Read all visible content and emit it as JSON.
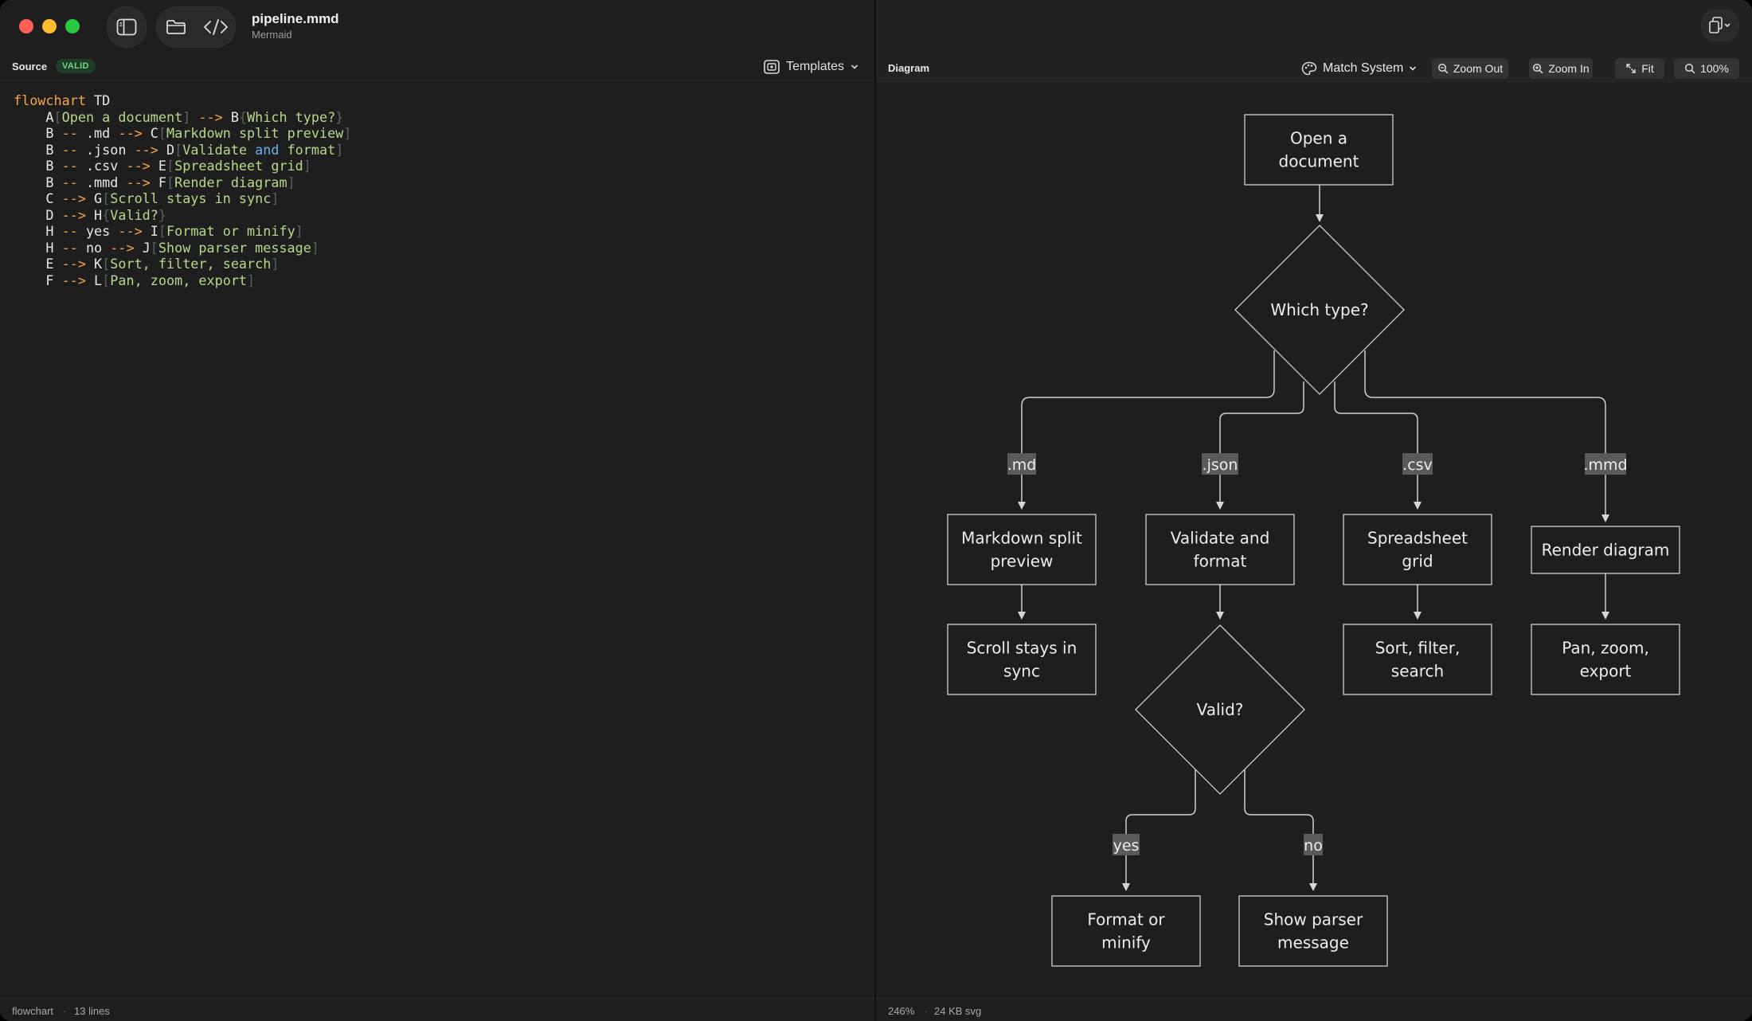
{
  "window": {
    "file_name": "pipeline.mmd",
    "file_type": "Mermaid"
  },
  "icons": {
    "sidebar": "sidebar-toggle-icon",
    "folder": "folder-icon",
    "code": "code-icon",
    "templates": "templates-icon",
    "theme": "palette-icon",
    "zoom": "magnifier-icon",
    "fit": "fit-arrows-icon",
    "export": "export-copy-icon"
  },
  "colors": {
    "valid_badge_bg": "#1f3d26",
    "valid_badge_fg": "#6fd481",
    "keyword": "#f5a54a",
    "string": "#b5d98a",
    "highlight": "#63b3ed"
  },
  "source": {
    "label": "Source",
    "status": "VALID",
    "templates_label": "Templates",
    "lines": [
      [
        {
          "t": "flowchart",
          "c": "kw"
        },
        {
          "t": " TD",
          "c": "id"
        }
      ],
      [
        {
          "t": "    A",
          "c": "id"
        },
        {
          "t": "[",
          "c": "br"
        },
        {
          "t": "Open a document",
          "c": "lbl"
        },
        {
          "t": "]",
          "c": "br"
        },
        {
          "t": " -->",
          "c": "arrow"
        },
        {
          "t": " B",
          "c": "id"
        },
        {
          "t": "{",
          "c": "br"
        },
        {
          "t": "Which type?",
          "c": "lbl"
        },
        {
          "t": "}",
          "c": "br"
        }
      ],
      [
        {
          "t": "    B ",
          "c": "id"
        },
        {
          "t": "--",
          "c": "arrow"
        },
        {
          "t": " .md ",
          "c": "id"
        },
        {
          "t": "-->",
          "c": "arrow"
        },
        {
          "t": " C",
          "c": "id"
        },
        {
          "t": "[",
          "c": "br"
        },
        {
          "t": "Markdown split preview",
          "c": "lbl"
        },
        {
          "t": "]",
          "c": "br"
        }
      ],
      [
        {
          "t": "    B ",
          "c": "id"
        },
        {
          "t": "--",
          "c": "arrow"
        },
        {
          "t": " .json ",
          "c": "id"
        },
        {
          "t": "-->",
          "c": "arrow"
        },
        {
          "t": " D",
          "c": "id"
        },
        {
          "t": "[",
          "c": "br"
        },
        {
          "t": "Validate ",
          "c": "lbl"
        },
        {
          "t": "and",
          "c": "hl"
        },
        {
          "t": " format",
          "c": "lbl"
        },
        {
          "t": "]",
          "c": "br"
        }
      ],
      [
        {
          "t": "    B ",
          "c": "id"
        },
        {
          "t": "--",
          "c": "arrow"
        },
        {
          "t": " .csv ",
          "c": "id"
        },
        {
          "t": "-->",
          "c": "arrow"
        },
        {
          "t": " E",
          "c": "id"
        },
        {
          "t": "[",
          "c": "br"
        },
        {
          "t": "Spreadsheet grid",
          "c": "lbl"
        },
        {
          "t": "]",
          "c": "br"
        }
      ],
      [
        {
          "t": "    B ",
          "c": "id"
        },
        {
          "t": "--",
          "c": "arrow"
        },
        {
          "t": " .mmd ",
          "c": "id"
        },
        {
          "t": "-->",
          "c": "arrow"
        },
        {
          "t": " F",
          "c": "id"
        },
        {
          "t": "[",
          "c": "br"
        },
        {
          "t": "Render diagram",
          "c": "lbl"
        },
        {
          "t": "]",
          "c": "br"
        }
      ],
      [
        {
          "t": "    C ",
          "c": "id"
        },
        {
          "t": "-->",
          "c": "arrow"
        },
        {
          "t": " G",
          "c": "id"
        },
        {
          "t": "[",
          "c": "br"
        },
        {
          "t": "Scroll stays in sync",
          "c": "lbl"
        },
        {
          "t": "]",
          "c": "br"
        }
      ],
      [
        {
          "t": "    D ",
          "c": "id"
        },
        {
          "t": "-->",
          "c": "arrow"
        },
        {
          "t": " H",
          "c": "id"
        },
        {
          "t": "{",
          "c": "br"
        },
        {
          "t": "Valid?",
          "c": "lbl"
        },
        {
          "t": "}",
          "c": "br"
        }
      ],
      [
        {
          "t": "    H ",
          "c": "id"
        },
        {
          "t": "--",
          "c": "arrow"
        },
        {
          "t": " yes ",
          "c": "id"
        },
        {
          "t": "-->",
          "c": "arrow"
        },
        {
          "t": " I",
          "c": "id"
        },
        {
          "t": "[",
          "c": "br"
        },
        {
          "t": "Format or minify",
          "c": "lbl"
        },
        {
          "t": "]",
          "c": "br"
        }
      ],
      [
        {
          "t": "    H ",
          "c": "id"
        },
        {
          "t": "--",
          "c": "arrow"
        },
        {
          "t": " no ",
          "c": "id"
        },
        {
          "t": "-->",
          "c": "arrow"
        },
        {
          "t": " J",
          "c": "id"
        },
        {
          "t": "[",
          "c": "br"
        },
        {
          "t": "Show parser message",
          "c": "lbl"
        },
        {
          "t": "]",
          "c": "br"
        }
      ],
      [
        {
          "t": "    E ",
          "c": "id"
        },
        {
          "t": "-->",
          "c": "arrow"
        },
        {
          "t": " K",
          "c": "id"
        },
        {
          "t": "[",
          "c": "br"
        },
        {
          "t": "Sort, filter, search",
          "c": "lbl"
        },
        {
          "t": "]",
          "c": "br"
        }
      ],
      [
        {
          "t": "    F ",
          "c": "id"
        },
        {
          "t": "-->",
          "c": "arrow"
        },
        {
          "t": " L",
          "c": "id"
        },
        {
          "t": "[",
          "c": "br"
        },
        {
          "t": "Pan, zoom, export",
          "c": "lbl"
        },
        {
          "t": "]",
          "c": "br"
        }
      ]
    ],
    "status_type": "flowchart",
    "status_lines": "13 lines"
  },
  "diagram": {
    "label": "Diagram",
    "theme_label": "Match System",
    "zoom_out_label": "Zoom Out",
    "zoom_in_label": "Zoom In",
    "fit_label": "Fit",
    "zoom_level": "100%",
    "status_zoom": "246%",
    "status_size": "24 KB svg",
    "nodes": {
      "A": [
        "Open a",
        "document"
      ],
      "B": [
        "Which type?"
      ],
      "C": [
        "Markdown split",
        "preview"
      ],
      "D": [
        "Validate and",
        "format"
      ],
      "E": [
        "Spreadsheet",
        "grid"
      ],
      "F": [
        "Render diagram"
      ],
      "G": [
        "Scroll stays in",
        "sync"
      ],
      "H": [
        "Valid?"
      ],
      "I": [
        "Format or",
        "minify"
      ],
      "J": [
        "Show parser",
        "message"
      ],
      "K": [
        "Sort, filter,",
        "search"
      ],
      "L": [
        "Pan, zoom,",
        "export"
      ]
    },
    "edge_labels": {
      "md": ".md",
      "json": ".json",
      "csv": ".csv",
      "mmd": ".mmd",
      "yes": "yes",
      "no": "no"
    }
  }
}
